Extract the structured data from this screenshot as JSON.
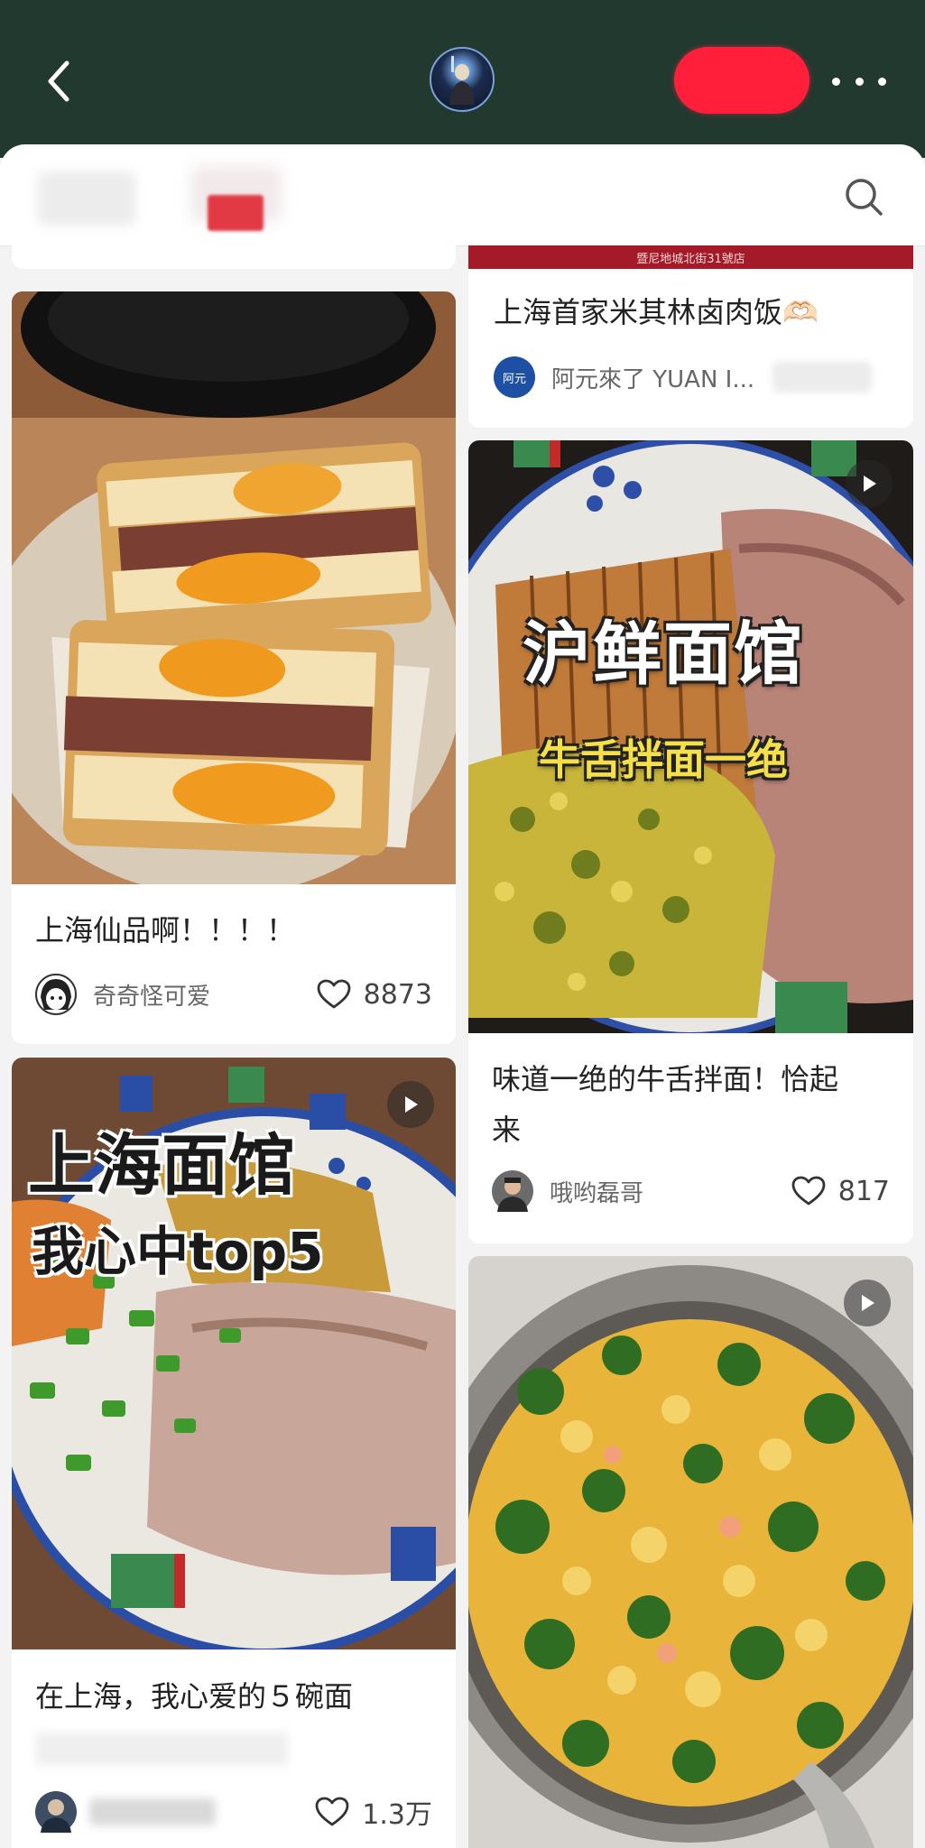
{
  "header": {
    "back_icon": "chevron-left-icon",
    "more_icon": "more-dots-icon",
    "search_icon": "search-icon"
  },
  "cards": {
    "c0": {
      "address_strip": "暨尼地城北街31號店",
      "title": "上海首家米其林卤肉饭🫶🏻",
      "author": "阿元來了 YUAN I...",
      "avatar_text": "阿元"
    },
    "c1": {
      "title": "上海仙品啊！！！！",
      "author": "奇奇怪可爱",
      "likes": "8873"
    },
    "c2": {
      "overlay_title": "沪鲜面馆",
      "overlay_subtitle": "牛舌拌面一绝",
      "title_line1": "味道一绝的牛舌拌面！恰起",
      "title_line2": "来",
      "author": "哦哟磊哥",
      "likes": "817"
    },
    "c3": {
      "overlay_title": "上海面馆",
      "overlay_subtitle": "我心中top5",
      "title": "在上海，我心爱的５碗面",
      "likes": "1.3万"
    }
  },
  "colors": {
    "header_bg": "#22392f",
    "accent_red": "#ff1f3a",
    "page_bg": "#f3f3f3"
  }
}
